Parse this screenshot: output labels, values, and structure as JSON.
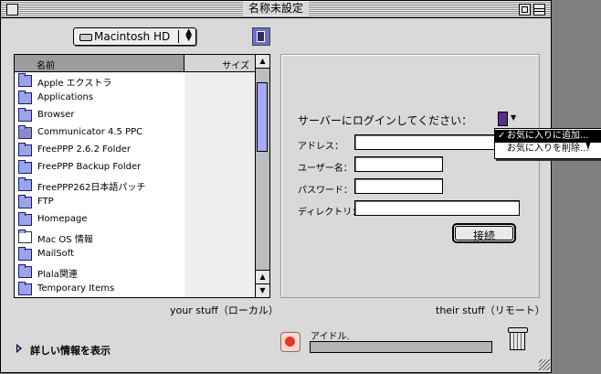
{
  "window": {
    "title": "名称未設定"
  },
  "volume_popup": {
    "label": "Macintosh HD"
  },
  "file_list": {
    "columns": [
      "名前",
      "サイズ"
    ],
    "items": [
      {
        "name": "Apple エクストラ",
        "icon": "special-folder-icon"
      },
      {
        "name": "Applications",
        "icon": "folder-icon"
      },
      {
        "name": "Browser",
        "icon": "folder-icon"
      },
      {
        "name": "Communicator 4.5 PPC",
        "icon": "application-icon"
      },
      {
        "name": "FreePPP 2.6.2 Folder",
        "icon": "folder-icon"
      },
      {
        "name": "FreePPP Backup Folder",
        "icon": "folder-icon"
      },
      {
        "name": "FreePPP262日本語パッチ",
        "icon": "folder-icon"
      },
      {
        "name": "FTP",
        "icon": "folder-icon"
      },
      {
        "name": "Homepage",
        "icon": "folder-icon"
      },
      {
        "name": "Mac OS 情報",
        "icon": "document-icon"
      },
      {
        "name": "MailSoft",
        "icon": "folder-icon"
      },
      {
        "name": "Plala関連",
        "icon": "folder-icon"
      },
      {
        "name": "Temporary Items",
        "icon": "folder-icon"
      }
    ]
  },
  "local_caption": "your stuff（ローカル）",
  "remote_caption": "their stuff（リモート）",
  "login": {
    "prompt": "サーバーにログインしてください：",
    "address_label": "アドレス：",
    "username_label": "ユーザー名：",
    "password_label": "パスワード：",
    "directory_label": "ディレクトリ：",
    "connect_label": "接続"
  },
  "favorites_menu": {
    "items": [
      {
        "label": "お気に入りに追加...",
        "checked": true,
        "highlighted": true
      },
      {
        "label": "お気に入りを削除...",
        "checked": false,
        "highlighted": false
      }
    ],
    "check_mark": "✓"
  },
  "details_toggle": "詳しい情報を表示",
  "status_text": "アイドル.",
  "progress": 0
}
